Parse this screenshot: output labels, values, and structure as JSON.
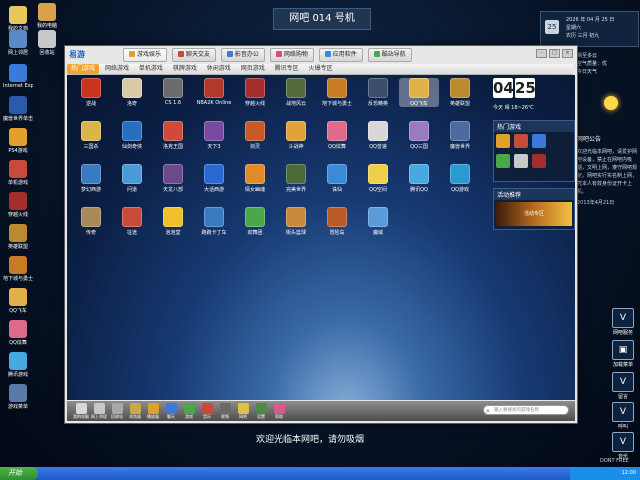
{
  "banner": {
    "title": "网吧 014 号机"
  },
  "desktop_icons": [
    "我的文档",
    "我的电脑",
    "网上邻居",
    "回收站",
    "Internet Explorer",
    "魔兽世界单击版",
    "PS4游戏",
    "单机游戏",
    "穿越火线",
    "英雄联盟",
    "地下城与勇士",
    "QQ飞车",
    "QQ炫舞",
    "腾讯游戏",
    "游戏菜单"
  ],
  "calendar": {
    "day": "25",
    "line1": "2026 年 04 月 25 日",
    "line2": "星期六",
    "line3": "农历 三月 初九"
  },
  "weather": {
    "l1": "晴至多云",
    "l2": "空气质量：优",
    "l3": "今日天气"
  },
  "notice": {
    "title": "网吧公告",
    "body": "欢迎光临本网吧，请爱护网吧设备，禁止在网吧内吸烟，文明上网，遵守网吧规定。网吧实行实名制上网，凭本人有效身份证开卡上机。",
    "date": "2013年4月21日"
  },
  "right_buttons": [
    "网吧服务",
    "加载菜单",
    "留言",
    "呼叫",
    "音乐"
  ],
  "dont_free": "DONT FREE",
  "welcome": "欢迎光临本网吧，请勿吸烟",
  "taskbar": {
    "start": "开始",
    "clock": "12:00"
  },
  "window": {
    "logo": "易游",
    "categories": [
      "游戏娱乐",
      "聊天交友",
      "影音办公",
      "网络购物",
      "应用软件",
      "酷站导航"
    ],
    "subtabs": [
      "热门游戏",
      "网络游戏",
      "单机游戏",
      "棋牌游戏",
      "休闲游戏",
      "网页游戏",
      "腾讯专区",
      "火爆专区"
    ],
    "apps": [
      {
        "label": "逆战",
        "c": "#c9341f"
      },
      {
        "label": "洛奇",
        "c": "#d8c9a8"
      },
      {
        "label": "CS 1.6",
        "c": "#6b6b6b"
      },
      {
        "label": "NBA2K Online",
        "c": "#b23a2a"
      },
      {
        "label": "穿越火线",
        "c": "#a62d2d"
      },
      {
        "label": "战地风云",
        "c": "#556a3a"
      },
      {
        "label": "地下城与勇士",
        "c": "#c87a24"
      },
      {
        "label": "反恐精英",
        "c": "#3b4d6b"
      },
      {
        "label": "QQ飞车",
        "c": "#e0b34a"
      },
      {
        "label": "英雄联盟",
        "c": "#b98a2e"
      },
      {
        "label": "三国杀",
        "c": "#d8b64a"
      },
      {
        "label": "仙剑奇侠",
        "c": "#2a6ec0"
      },
      {
        "label": "洛克王国",
        "c": "#d04a3a"
      },
      {
        "label": "天下3",
        "c": "#7a4aa0"
      },
      {
        "label": "剑灵",
        "c": "#c85a2a"
      },
      {
        "label": "斗战神",
        "c": "#e0a23a"
      },
      {
        "label": "QQ炫舞",
        "c": "#e06a8a"
      },
      {
        "label": "QQ音速",
        "c": "#d8d8d8"
      },
      {
        "label": "QQ三国",
        "c": "#9a7ac0"
      },
      {
        "label": "魔兽世界",
        "c": "#4a6aa0"
      },
      {
        "label": "梦幻西游",
        "c": "#3a7ac0"
      },
      {
        "label": "问道",
        "c": "#4a9ad8"
      },
      {
        "label": "天龙八部",
        "c": "#6a4a8a"
      },
      {
        "label": "大话西游",
        "c": "#2a6ad0"
      },
      {
        "label": "倩女幽魂",
        "c": "#e08a2a"
      },
      {
        "label": "完美世界",
        "c": "#4a6a3a"
      },
      {
        "label": "诛仙",
        "c": "#3a8ad8"
      },
      {
        "label": "QQ空间",
        "c": "#f0d04a"
      },
      {
        "label": "腾讯QQ",
        "c": "#4aa8e0"
      },
      {
        "label": "QQ游戏",
        "c": "#2a9ad0"
      },
      {
        "label": "传奇",
        "c": "#a88a5a"
      },
      {
        "label": "征途",
        "c": "#c84a3a"
      },
      {
        "label": "泡泡堂",
        "c": "#f0c02a"
      },
      {
        "label": "跑跑卡丁车",
        "c": "#3a7ac0"
      },
      {
        "label": "劲舞团",
        "c": "#4aa84a"
      },
      {
        "label": "街头篮球",
        "c": "#c88a3a"
      },
      {
        "label": "冒险岛",
        "c": "#b85a2a"
      },
      {
        "label": "魔域",
        "c": "#5a9ad8"
      }
    ],
    "side": {
      "d1": "04",
      "d2": "25",
      "weather": "今天 晴 18~26℃",
      "hot_title": "热门游戏",
      "promo_title": "活动推荐",
      "promo": "活动专区"
    },
    "bottom_items": [
      "我的电脑",
      "网上邻居",
      "回收站",
      "浏览器",
      "播放器",
      "聊天",
      "游戏",
      "音乐",
      "视频",
      "网吧",
      "设置",
      "帮助"
    ],
    "search_placeholder": "输入要搜索的游戏名称"
  }
}
